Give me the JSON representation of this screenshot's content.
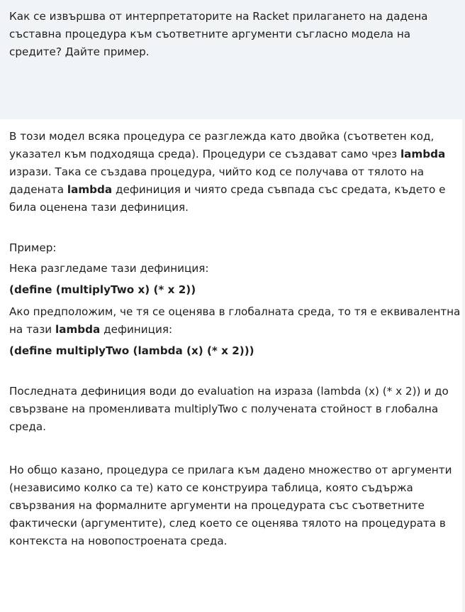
{
  "question": {
    "text": "Как се извършва от интерпретаторите на Racket прилагането на дадена съставна процедура към съответните аргументи съгласно модела на средите? Дайте пример."
  },
  "answer": {
    "p1": {
      "a": "В този модел всяка процедура се разглежда като двойка (съответен код, указател към подходяща среда). Процедури се създават само чрез ",
      "kw1": "lambda",
      "b": " изрази. Така се създава процедура, чийто код се получава от тялото на дадената ",
      "kw2": "lambda",
      "c": " дефиниция и чиято среда съвпада със средата, където е била оценена тази дефиниция."
    },
    "example_label": "Пример:",
    "consider": "Нека разгледаме тази дефиниция:",
    "code1": "(define (multiplyTwo x) (* x 2))",
    "p_assume": {
      "a": "Ако предположим, че тя се оценява в глобалната среда, то тя е еквивалентна на тази ",
      "kw": "lambda",
      "b": " дефиниция:"
    },
    "code2": "(define multiplyTwo (lambda (x) (* x 2)))",
    "p_last_def": "Последната дефиниция води до evaluation на израза (lambda (x) (* x 2)) и до свързване на променливата multiplyTwo с получената стойност в глобална среда.",
    "p_general": "Но общо казано, процедура се прилага към дадено множество от аргументи (независимо колко са те) като се конструира таблица, която съдържа свързвания на формалните аргументи на процедурата със съответните фактически (аргументите), след което се оценява тялото на процедурата в контекста на новопостроената среда."
  }
}
